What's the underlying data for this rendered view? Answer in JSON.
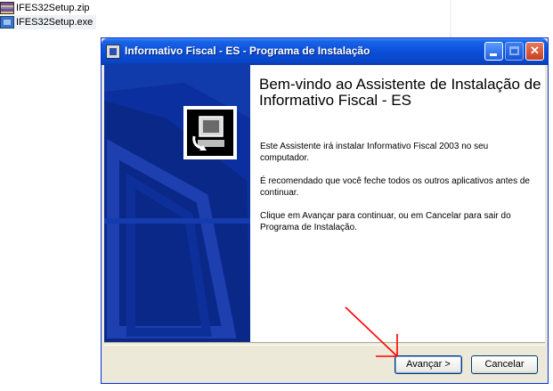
{
  "desktop": {
    "files": [
      {
        "name": "IFES32Setup.zip",
        "icon": "winrar-archive-icon"
      },
      {
        "name": "IFES32Setup.exe",
        "icon": "installer-exe-icon"
      }
    ]
  },
  "window": {
    "title": "Informativo Fiscal - ES - Programa de Instalação",
    "controls": {
      "minimize": "minimize-icon",
      "maximize": "maximize-icon",
      "close": "close-icon"
    }
  },
  "wizard": {
    "heading": "Bem-vindo ao Assistente de Instalação de Informativo Fiscal - ES",
    "paragraphs": [
      "Este Assistente irá instalar Informativo Fiscal 2003 no seu computador.",
      "É recomendado que você feche todos os outros aplicativos antes de continuar.",
      "Clique em Avançar para continuar, ou em Cancelar para sair do Programa de Instalação."
    ]
  },
  "buttons": {
    "next": "Avançar >",
    "cancel": "Cancelar"
  },
  "colors": {
    "titlebar": "#0a4fd8",
    "side_panel": "#0b2f9e",
    "annotation_arrow": "#ff0000"
  }
}
